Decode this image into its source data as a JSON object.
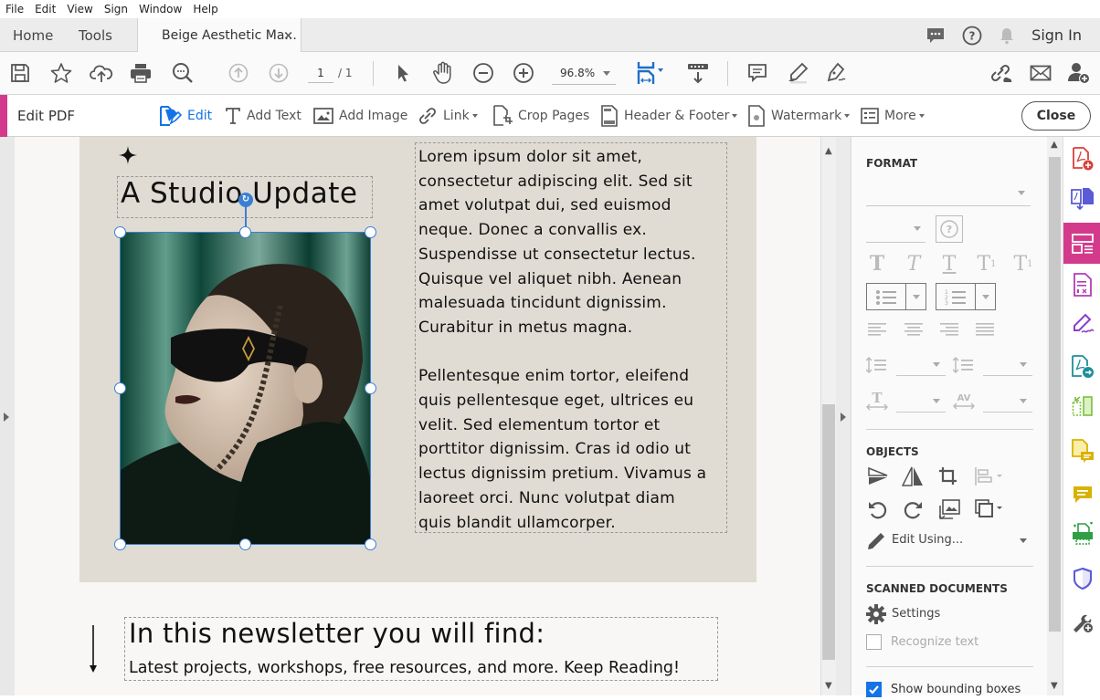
{
  "menu": [
    "File",
    "Edit",
    "View",
    "Sign",
    "Window",
    "Help"
  ],
  "tabs": {
    "home": "Home",
    "tools": "Tools",
    "document": "Beige Aesthetic Ma...",
    "close_glyph": "×"
  },
  "header_right": {
    "sign_in": "Sign In",
    "icons": [
      "chat-icon",
      "help-icon",
      "bell-icon"
    ]
  },
  "toolbar": {
    "page_current": "1",
    "page_total": "/ 1",
    "zoom": "96.8%",
    "icons": [
      "save-icon",
      "star-icon",
      "upload-icon",
      "print-icon",
      "zoom-search-icon",
      "page-up-icon",
      "page-down-icon",
      "select-arrow-icon",
      "hand-icon",
      "zoom-out-icon",
      "zoom-in-icon",
      "fit-page-icon",
      "scroll-mode-icon",
      "comment-icon",
      "highlight-icon",
      "sign-pen-icon",
      "share-link-icon",
      "email-icon",
      "add-user-icon"
    ]
  },
  "editbar": {
    "title": "Edit PDF",
    "items": [
      {
        "label": "Edit",
        "icon": "edit-icon",
        "active": true
      },
      {
        "label": "Add Text",
        "icon": "add-text-icon"
      },
      {
        "label": "Add Image",
        "icon": "add-image-icon"
      },
      {
        "label": "Link",
        "icon": "link-icon",
        "dropdown": true
      },
      {
        "label": "Crop Pages",
        "icon": "crop-pages-icon"
      },
      {
        "label": "Header & Footer",
        "icon": "header-footer-icon",
        "dropdown": true
      },
      {
        "label": "Watermark",
        "icon": "watermark-icon",
        "dropdown": true
      },
      {
        "label": "More",
        "icon": "more-icon",
        "dropdown": true
      }
    ],
    "close_label": "Close",
    "accent_color": "#d43a8c",
    "active_color": "#1473e6"
  },
  "document": {
    "title": "A Studio Update",
    "paragraphs": [
      "Lorem ipsum dolor sit amet,\nconsectetur adipiscing elit. Sed sit\namet volutpat dui, sed euismod\nneque. Donec a convallis ex.\nSuspendisse ut consectetur lectus.\nQuisque vel aliquet nibh. Aenean\nmalesuada tincidunt dignissim.\nCurabitur in metus magna.",
      "Pellentesque enim tortor, eleifend\nquis pellentesque eget, ultrices eu\nvelit. Sed elementum tortor et\nporttitor dignissim. Cras id odio ut\nlectus dignissim pretium. Vivamus a\nlaoreet orci. Nunc volutpat diam\nquis blandit ullamcorper."
    ],
    "newsletter_heading": "In this newsletter you will find:",
    "newsletter_sub": "Latest projects, workshops, free resources, and more. Keep Reading!",
    "image_desc": "Portrait of woman in dark sunglasses with braids, teal background",
    "page_bg": "#e0dcd3"
  },
  "format_panel": {
    "format_heading": "FORMAT",
    "objects_heading": "OBJECTS",
    "edit_using": "Edit Using...",
    "scanned_heading": "SCANNED DOCUMENTS",
    "settings_label": "Settings",
    "recognize_text": "Recognize text",
    "recognize_checked": false,
    "show_bounding": "Show bounding boxes",
    "show_bounding_checked": true
  },
  "rail": {
    "items": [
      "create-pdf-icon",
      "export-pdf-icon",
      "edit-pdf-icon",
      "fill-form-icon",
      "fill-sign-icon",
      "send-review-icon",
      "organize-pages-icon",
      "comment-file-icon",
      "comment-icon",
      "scan-icon",
      "protect-icon",
      "more-tools-icon"
    ],
    "active_index": 2
  }
}
